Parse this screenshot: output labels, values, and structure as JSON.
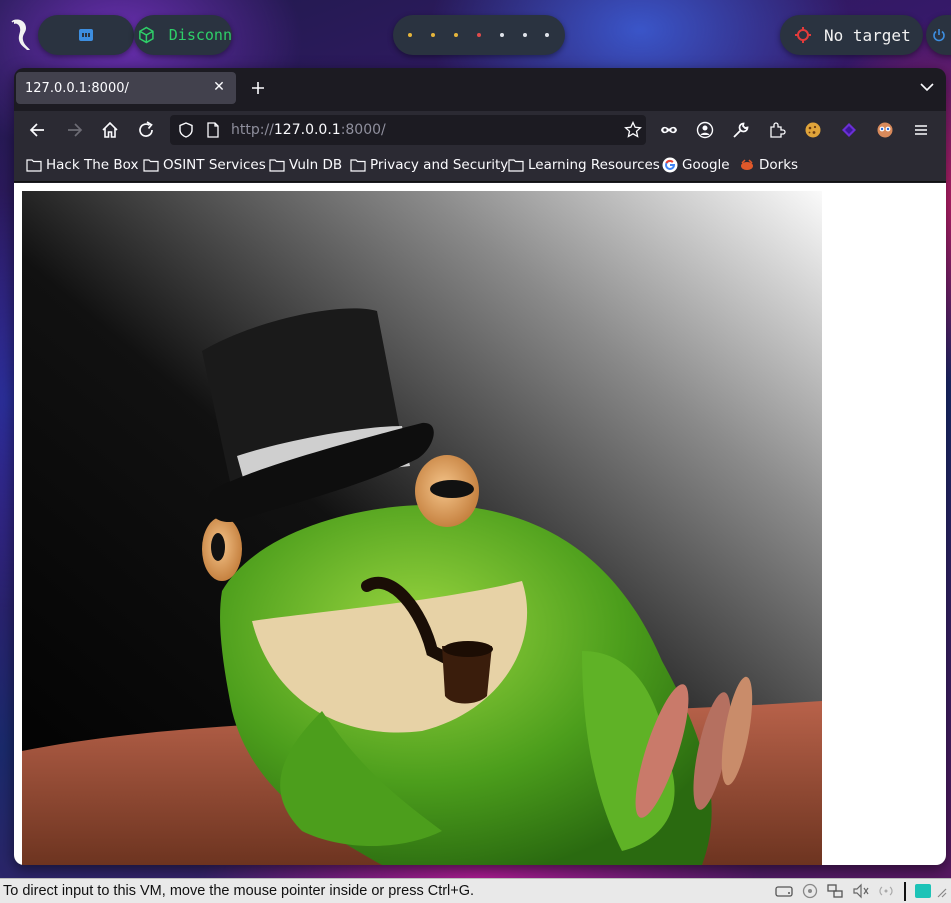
{
  "desktop_panel": {
    "vpn_status": "Disconn",
    "target_label": "No target",
    "workspace_dot_colors": [
      "#e5b53b",
      "#e5b53b",
      "#e5b53b",
      "#e04b4b",
      "#dfe3ea",
      "#dfe3ea",
      "#dfe3ea"
    ],
    "accent_green": "#2ecf68",
    "accent_red": "#e33b3b"
  },
  "browser": {
    "tab": {
      "title": "127.0.0.1:8000/"
    },
    "address_bar": {
      "scheme": "http://",
      "host": "127.0.0.1",
      "rest": ":8000/"
    },
    "bookmarks": [
      {
        "label": "Hack The Box",
        "icon": "folder-icon"
      },
      {
        "label": "OSINT Services",
        "icon": "folder-icon"
      },
      {
        "label": "Vuln DB",
        "icon": "folder-icon"
      },
      {
        "label": "Privacy and Security",
        "icon": "folder-icon"
      },
      {
        "label": "Learning Resources",
        "icon": "folder-icon"
      },
      {
        "label": "Google",
        "icon": "google-icon"
      },
      {
        "label": "Dorks",
        "icon": "dorks-icon"
      }
    ],
    "page": {
      "image_subject": "frog-with-top-hat-and-pipe"
    }
  },
  "vm_status_bar": {
    "message": "To direct input to this VM, move the mouse pointer inside or press Ctrl+G."
  }
}
